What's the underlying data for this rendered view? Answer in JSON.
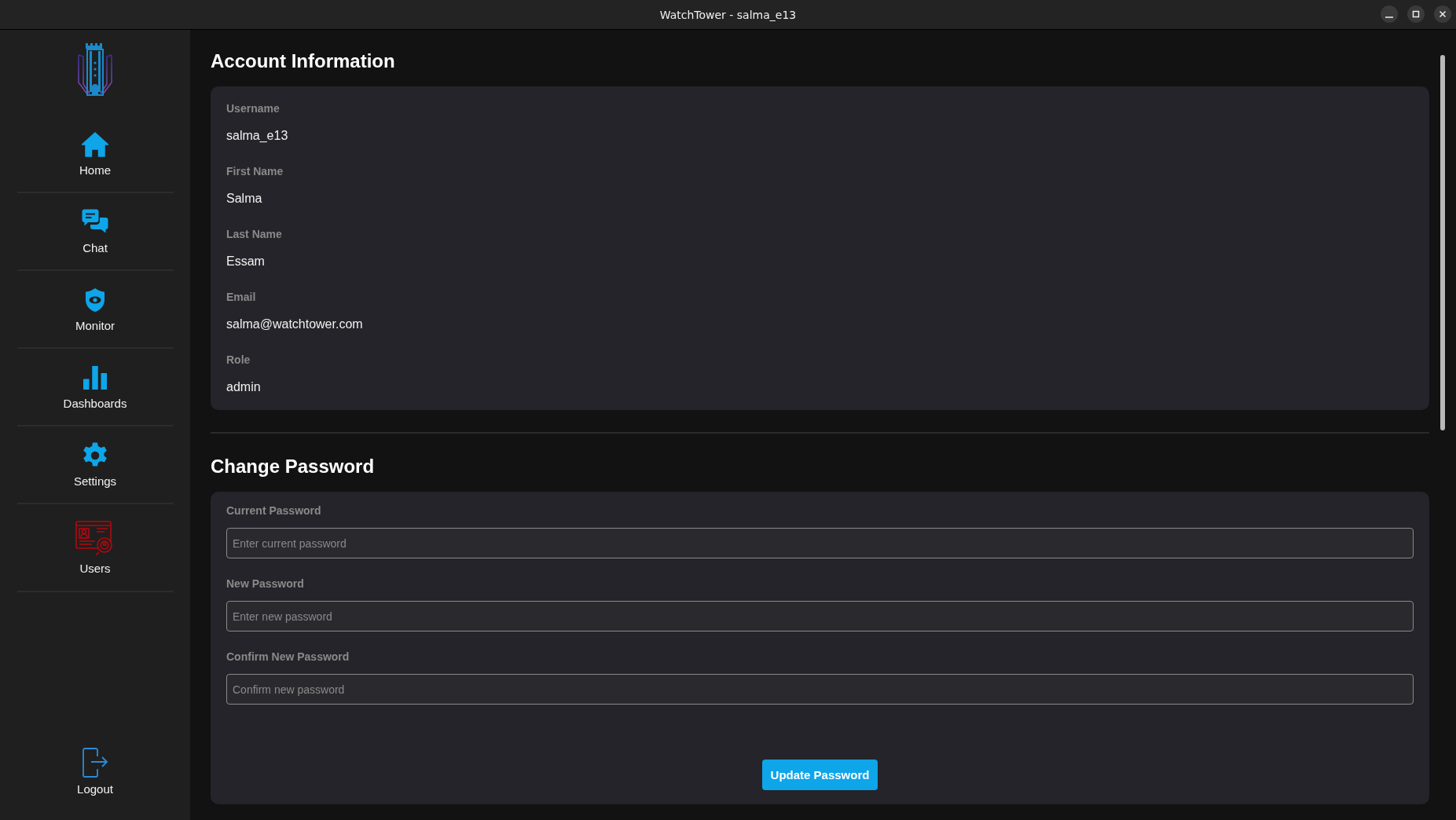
{
  "window": {
    "title": "WatchTower - salma_e13"
  },
  "sidebar": {
    "items": [
      {
        "kind": "home",
        "label": "Home"
      },
      {
        "kind": "chat",
        "label": "Chat"
      },
      {
        "kind": "monitor",
        "label": "Monitor"
      },
      {
        "kind": "dashboards",
        "label": "Dashboards"
      },
      {
        "kind": "settings",
        "label": "Settings"
      },
      {
        "kind": "users",
        "label": "Users"
      }
    ],
    "logout": {
      "label": "Logout"
    }
  },
  "account": {
    "title": "Account Information",
    "fields": [
      {
        "label": "Username",
        "value": "salma_e13"
      },
      {
        "label": "First Name",
        "value": "Salma"
      },
      {
        "label": "Last Name",
        "value": "Essam"
      },
      {
        "label": "Email",
        "value": "salma@watchtower.com"
      },
      {
        "label": "Role",
        "value": "admin"
      }
    ]
  },
  "password": {
    "title": "Change Password",
    "fields": [
      {
        "label": "Current Password",
        "placeholder": "Enter current password"
      },
      {
        "label": "New Password",
        "placeholder": "Enter new password"
      },
      {
        "label": "Confirm New Password",
        "placeholder": "Confirm new password"
      }
    ],
    "button": "Update Password"
  }
}
